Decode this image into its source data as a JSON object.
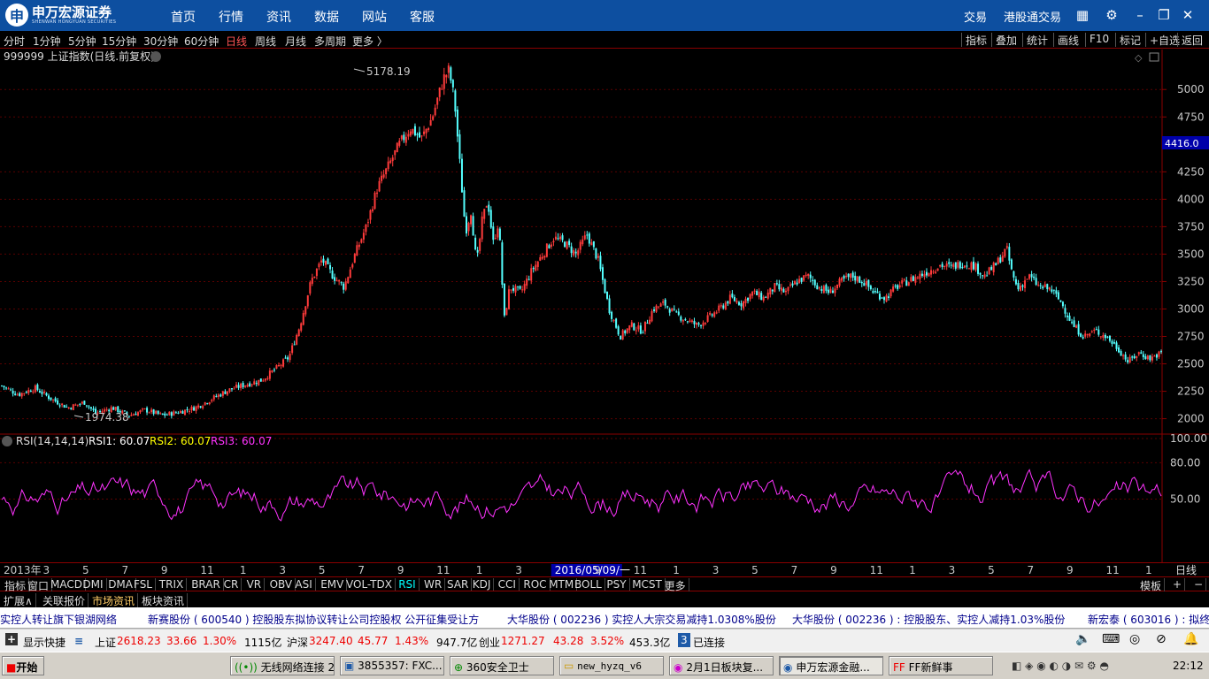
{
  "topbar": {
    "logo_name": "申万宏源证券",
    "logo_sub": "SHENWAN HONGYUAN SECURITIES",
    "nav": [
      "首页",
      "行情",
      "资讯",
      "数据",
      "网站",
      "客服"
    ],
    "right": [
      "交易",
      "港股通交易"
    ],
    "icons": [
      "grid-icon",
      "gear-icon",
      "minimize-icon",
      "restore-icon",
      "close-icon"
    ]
  },
  "periods": [
    "分时",
    "1分钟",
    "5分钟",
    "15分钟",
    "30分钟",
    "60分钟",
    "日线",
    "周线",
    "月线",
    "多周期",
    "更多 〉"
  ],
  "active_period": "日线",
  "tools": [
    "指标",
    "叠加",
    "统计",
    "画线",
    "F10",
    "标记",
    "+自选",
    "返回"
  ],
  "main_panel": {
    "title": "999999 上证指数(日线.前复权)",
    "high_label": "5178.19",
    "low_label": "1974.38",
    "current_price": "4416.0",
    "y_ticks": [
      "5000",
      "4750",
      "4250",
      "4000",
      "3750",
      "3500",
      "3250",
      "3000",
      "2750",
      "2500",
      "2250",
      "2000"
    ]
  },
  "rsi_panel": {
    "title": "RSI(14,14,14)",
    "rsi1": "RSI1: 60.07",
    "rsi2": "RSI2: 60.07",
    "rsi3": "RSI3: 60.07",
    "y_ticks": [
      "100.00",
      "80.00",
      "50.00"
    ]
  },
  "date_axis": {
    "labels": [
      "2013年",
      "3",
      "5",
      "7",
      "9",
      "11",
      "1",
      "3",
      "5",
      "7",
      "9",
      "11",
      "1",
      "3",
      "2016/05/09/一",
      "9",
      "11",
      "1",
      "3",
      "5",
      "7",
      "9",
      "11",
      "1",
      "3",
      "5",
      "7",
      "9",
      "11",
      "1"
    ],
    "period": "日线"
  },
  "indicators": [
    "指标",
    "窗口",
    "MACD",
    "DMI",
    "DMA",
    "FSL",
    "TRIX",
    "BRAR",
    "CR",
    "VR",
    "OBV",
    "ASI",
    "EMV",
    "VOL-TDX",
    "RSI",
    "WR",
    "SAR",
    "KDJ",
    "CCI",
    "ROC",
    "MTM",
    "BOLL",
    "PSY",
    "MCST",
    "更多"
  ],
  "active_indicator": "RSI",
  "indbar_right": [
    "模板",
    "+",
    "−"
  ],
  "ext_tabs": [
    "扩展∧",
    "关联报价",
    "市场资讯",
    "板块资讯"
  ],
  "active_ext": "市场资讯",
  "ticker": [
    "实控人转让旗下银湖网络",
    "新赛股份 ( 600540 ) 控股股东拟协议转让公司控股权  公开征集受让方",
    "大华股份 ( 002236 ) 实控人大宗交易减持1.0308%股份",
    "大华股份 ( 002236 ) : 控股股东、实控人减持1.03%股份",
    "新宏泰 ( 603016 ) : 拟终"
  ],
  "status": {
    "show_shortcut": "显示快捷",
    "sh_name": "上证",
    "sh_price": "2618.23",
    "sh_change": "33.66",
    "sh_pct": "1.30%",
    "sh_amount": "1115亿",
    "hs_name": "沪深",
    "hs_price": "3247.40",
    "hs_change": "45.77",
    "hs_pct": "1.43%",
    "hs_amount": "947.7亿",
    "cy_name": "创业",
    "cy_price": "1271.27",
    "cy_change": "43.28",
    "cy_pct": "3.52%",
    "cy_amount": "453.3亿",
    "conn_count": "3",
    "conn_text": "已连接",
    "up_color": "#ff0000"
  },
  "taskbar": {
    "start": "开始",
    "items": [
      "无线网络连接 2",
      "3855357: FXC...",
      "360安全卫士",
      "new_hyzq_v6",
      "2月1日板块复...",
      "申万宏源金融...",
      "FF新鲜事"
    ],
    "active_index": 5,
    "clock": "22:12"
  },
  "chart_data": {
    "type": "candlestick-with-rsi",
    "symbol": "999999 上证指数",
    "x_range": [
      "2013-01",
      "2017-02"
    ],
    "price_ylim": [
      1900,
      5300
    ],
    "price_path": [
      [
        0,
        2300
      ],
      [
        0.015,
        2220
      ],
      [
        0.03,
        2280
      ],
      [
        0.045,
        2180
      ],
      [
        0.06,
        2100
      ],
      [
        0.075,
        2150
      ],
      [
        0.085,
        2050
      ],
      [
        0.1,
        2100
      ],
      [
        0.115,
        2030
      ],
      [
        0.13,
        2080
      ],
      [
        0.145,
        2030
      ],
      [
        0.16,
        2060
      ],
      [
        0.175,
        2100
      ],
      [
        0.19,
        2180
      ],
      [
        0.205,
        2260
      ],
      [
        0.22,
        2310
      ],
      [
        0.235,
        2350
      ],
      [
        0.25,
        2470
      ],
      [
        0.26,
        2560
      ],
      [
        0.27,
        2850
      ],
      [
        0.28,
        3250
      ],
      [
        0.29,
        3450
      ],
      [
        0.3,
        3300
      ],
      [
        0.31,
        3200
      ],
      [
        0.32,
        3500
      ],
      [
        0.33,
        3750
      ],
      [
        0.34,
        4100
      ],
      [
        0.35,
        4300
      ],
      [
        0.36,
        4500
      ],
      [
        0.37,
        4650
      ],
      [
        0.38,
        4550
      ],
      [
        0.39,
        4750
      ],
      [
        0.4,
        5100
      ],
      [
        0.405,
        5178
      ],
      [
        0.41,
        4900
      ],
      [
        0.415,
        4300
      ],
      [
        0.42,
        3700
      ],
      [
        0.425,
        3900
      ],
      [
        0.43,
        3400
      ],
      [
        0.435,
        3800
      ],
      [
        0.44,
        4000
      ],
      [
        0.445,
        3600
      ],
      [
        0.45,
        3800
      ],
      [
        0.455,
        2900
      ],
      [
        0.46,
        3200
      ],
      [
        0.47,
        3150
      ],
      [
        0.48,
        3350
      ],
      [
        0.49,
        3500
      ],
      [
        0.5,
        3650
      ],
      [
        0.51,
        3600
      ],
      [
        0.52,
        3500
      ],
      [
        0.53,
        3680
      ],
      [
        0.54,
        3450
      ],
      [
        0.55,
        3000
      ],
      [
        0.56,
        2750
      ],
      [
        0.57,
        2850
      ],
      [
        0.58,
        2800
      ],
      [
        0.59,
        3000
      ],
      [
        0.6,
        3050
      ],
      [
        0.61,
        2950
      ],
      [
        0.62,
        2900
      ],
      [
        0.63,
        2850
      ],
      [
        0.64,
        2920
      ],
      [
        0.65,
        3000
      ],
      [
        0.66,
        3100
      ],
      [
        0.67,
        3050
      ],
      [
        0.68,
        3150
      ],
      [
        0.69,
        3100
      ],
      [
        0.7,
        3200
      ],
      [
        0.71,
        3150
      ],
      [
        0.72,
        3250
      ],
      [
        0.73,
        3300
      ],
      [
        0.74,
        3200
      ],
      [
        0.75,
        3150
      ],
      [
        0.76,
        3250
      ],
      [
        0.77,
        3300
      ],
      [
        0.78,
        3250
      ],
      [
        0.79,
        3150
      ],
      [
        0.8,
        3100
      ],
      [
        0.81,
        3200
      ],
      [
        0.82,
        3250
      ],
      [
        0.83,
        3300
      ],
      [
        0.84,
        3350
      ],
      [
        0.85,
        3400
      ],
      [
        0.86,
        3380
      ],
      [
        0.87,
        3420
      ],
      [
        0.88,
        3400
      ],
      [
        0.89,
        3300
      ],
      [
        0.9,
        3400
      ],
      [
        0.91,
        3550
      ],
      [
        0.915,
        3320
      ],
      [
        0.92,
        3180
      ],
      [
        0.93,
        3300
      ],
      [
        0.94,
        3200
      ],
      [
        0.95,
        3180
      ],
      [
        0.96,
        3050
      ],
      [
        0.97,
        2850
      ],
      [
        0.98,
        2750
      ],
      [
        0.99,
        2800
      ],
      [
        1.0,
        2750
      ],
      [
        1.01,
        2650
      ],
      [
        1.02,
        2520
      ],
      [
        1.03,
        2600
      ],
      [
        1.04,
        2550
      ],
      [
        1.05,
        2600
      ]
    ],
    "rsi_ylim": [
      0,
      100
    ],
    "rsi_value": 60.07
  }
}
